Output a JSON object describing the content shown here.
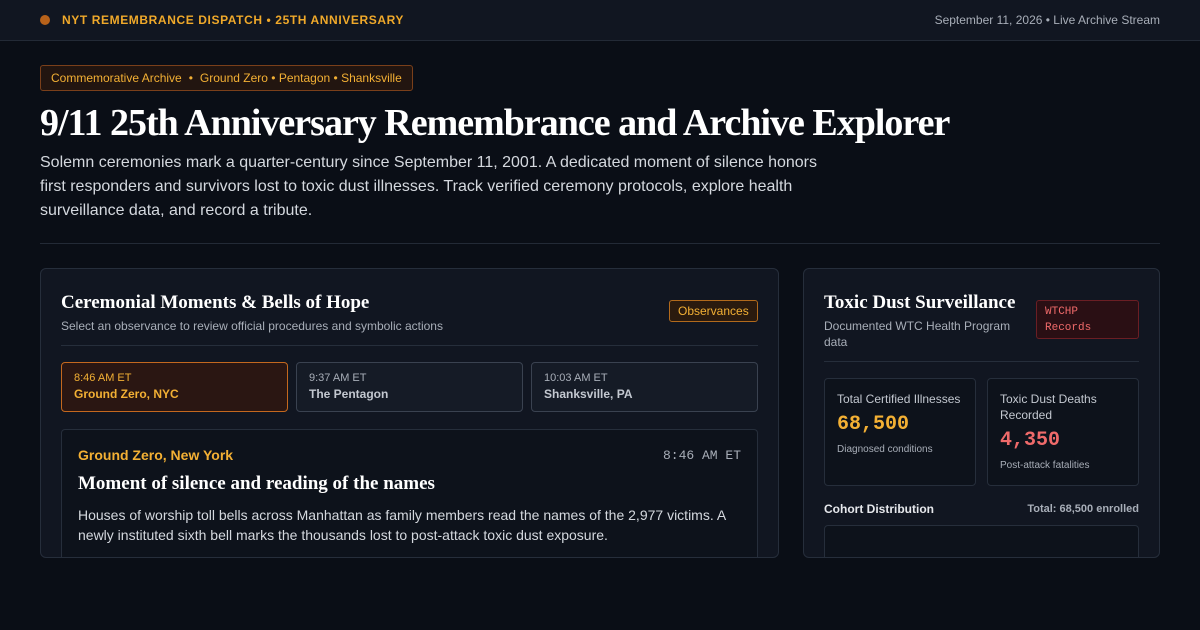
{
  "topbar": {
    "brand": "NYT REMEMBRANCE DISPATCH • 25TH ANNIVERSARY",
    "date": "September 11, 2026 • Live Archive Stream"
  },
  "tagline": {
    "archive": "Commemorative Archive",
    "separator": "•",
    "sites": "Ground Zero • Pentagon • Shanksville"
  },
  "title": "9/11 25th Anniversary Remembrance and Archive Explorer",
  "intro": "Solemn ceremonies mark a quarter-century since September 11, 2001. A dedicated moment of silence honors first responders and survivors lost to toxic dust illnesses. Track verified ceremony protocols, explore health surveillance data, and record a tribute.",
  "ceremonies": {
    "title": "Ceremonial Moments & Bells of Hope",
    "subtitle": "Select an observance to review official procedures and symbolic actions",
    "badge": "Observances",
    "tabs": [
      {
        "time": "8:46 AM ET",
        "location": "Ground Zero, NYC",
        "active": true
      },
      {
        "time": "9:37 AM ET",
        "location": "The Pentagon",
        "active": false
      },
      {
        "time": "10:03 AM ET",
        "location": "Shanksville, PA",
        "active": false
      }
    ],
    "detail": {
      "location": "Ground Zero, New York",
      "time": "8:46 AM ET",
      "title": "Moment of silence and reading of the names",
      "text": "Houses of worship toll bells across Manhattan as family members read the names of the 2,977 victims. A newly instituted sixth bell marks the thousands lost to post-attack toxic dust exposure."
    }
  },
  "surveillance": {
    "title": "Toxic Dust Surveillance",
    "subtitle": "Documented WTC Health Program data",
    "badge_line1": "WTCHP",
    "badge_line2": "Records",
    "stats": [
      {
        "label": "Total Certified Illnesses",
        "value": "68,500",
        "note": "Diagnosed conditions",
        "color": "#f3b034"
      },
      {
        "label": "Toxic Dust Deaths Recorded",
        "value": "4,350",
        "note": "Post-attack fatalities",
        "color": "#ef6a6a"
      }
    ],
    "cohort_label": "Cohort Distribution",
    "cohort_total": "Total: 68,500 enrolled"
  }
}
